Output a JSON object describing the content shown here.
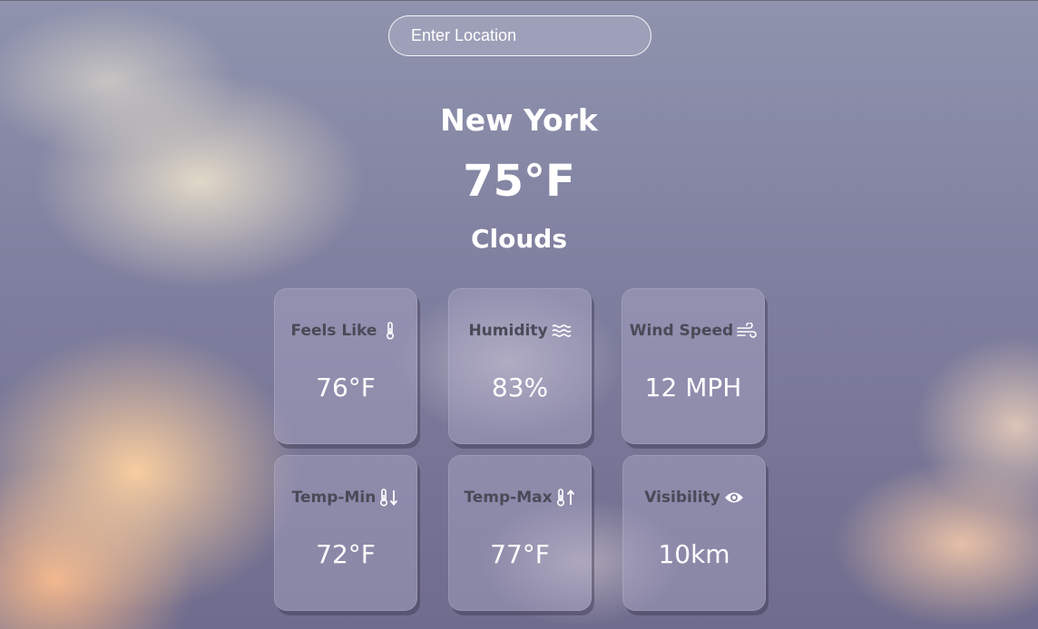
{
  "search": {
    "placeholder": "Enter Location"
  },
  "weather": {
    "city": "New York",
    "temperature": "75°F",
    "condition": "Clouds"
  },
  "cards": [
    {
      "label": "Feels Like",
      "value": "76°F",
      "icon": "thermometer-icon"
    },
    {
      "label": "Humidity",
      "value": "83%",
      "icon": "humidity-waves-icon"
    },
    {
      "label": "Wind Speed",
      "value": "12 MPH",
      "icon": "wind-icon"
    },
    {
      "label": "Temp-Min",
      "value": "72°F",
      "icon": "thermometer-down-icon"
    },
    {
      "label": "Temp-Max",
      "value": "77°F",
      "icon": "thermometer-up-icon"
    },
    {
      "label": "Visibility",
      "value": "10km",
      "icon": "eye-icon"
    }
  ],
  "colors": {
    "card_label": "#4a4a58",
    "text": "#ffffff"
  }
}
